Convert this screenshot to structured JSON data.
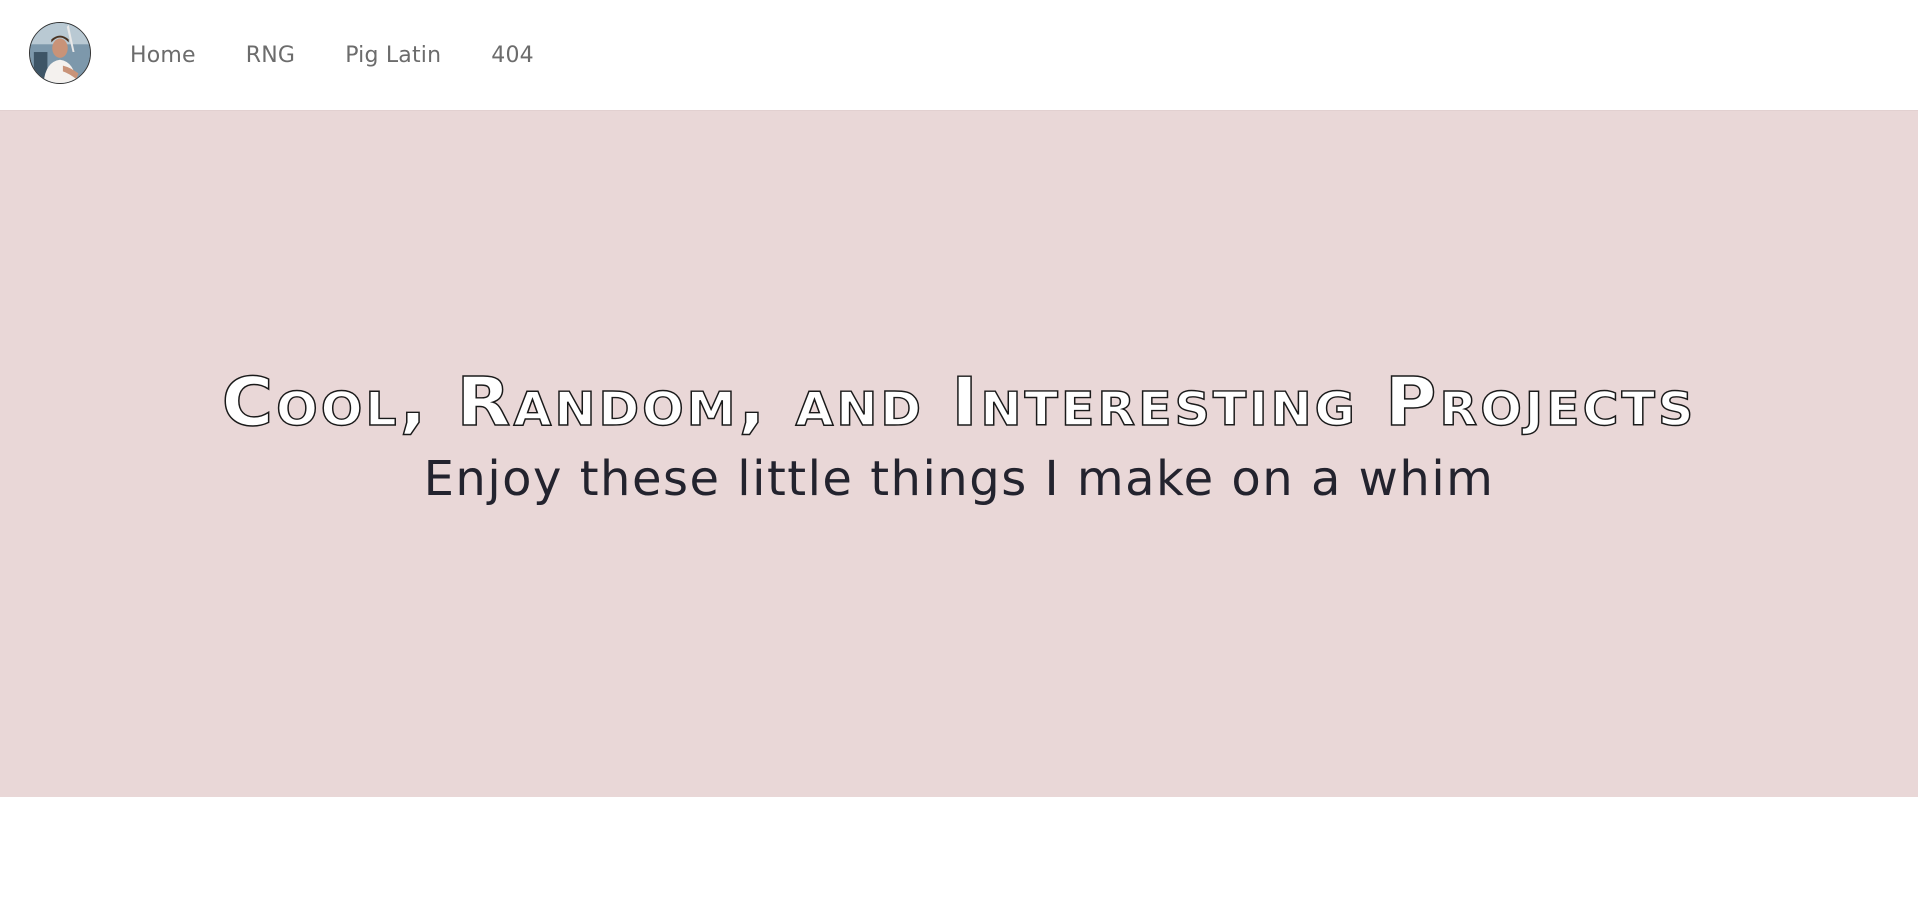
{
  "nav": {
    "avatar_icon": "profile-photo",
    "links": [
      {
        "label": "Home"
      },
      {
        "label": "RNG"
      },
      {
        "label": "Pig Latin"
      },
      {
        "label": "404"
      }
    ]
  },
  "hero": {
    "title": "Cool, Random, and Interesting Projects",
    "subtitle": "Enjoy these little things I make on a whim",
    "background_color": "#e9d7d7"
  }
}
